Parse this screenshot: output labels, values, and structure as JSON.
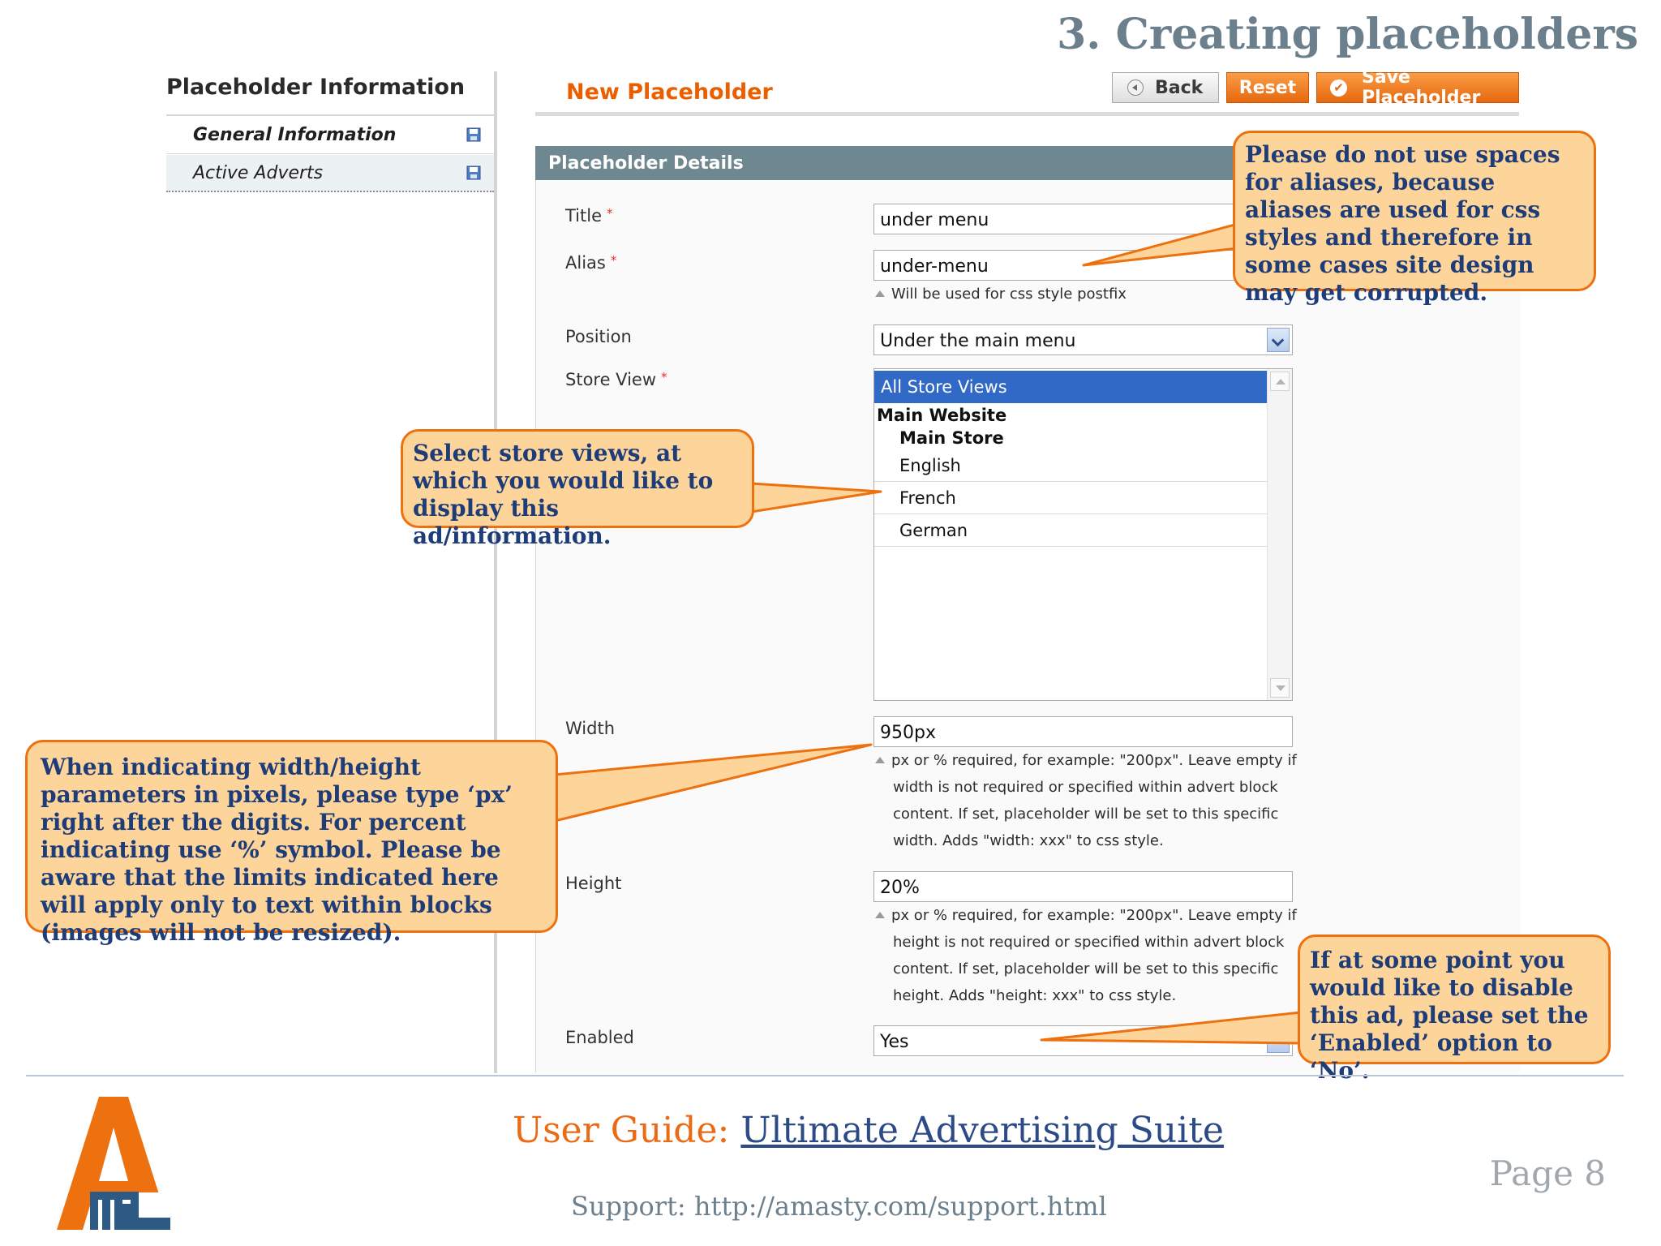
{
  "header": {
    "title": "3. Creating placeholders"
  },
  "sidebar": {
    "heading": "Placeholder Information",
    "items": [
      {
        "label": "General Information",
        "icon": "save-icon"
      },
      {
        "label": "Active Adverts",
        "icon": "save-icon"
      }
    ]
  },
  "form": {
    "heading": "New Placeholder",
    "buttons": {
      "back": "Back",
      "reset": "Reset",
      "save": "Save Placeholder"
    },
    "fieldset_title": "Placeholder Details",
    "required_mark": "*",
    "title": {
      "label": "Title",
      "value": "under menu"
    },
    "alias": {
      "label": "Alias",
      "value": "under-menu",
      "note": "Will be used for css style postfix"
    },
    "position": {
      "label": "Position",
      "value": "Under the main menu"
    },
    "store_view": {
      "label": "Store View",
      "selected": "All Store Views",
      "group": "Main Website",
      "subgroup": "Main Store",
      "options": [
        "English",
        "French",
        "German"
      ]
    },
    "width": {
      "label": "Width",
      "value": "950px",
      "note_lines": [
        "px or % required, for example: \"200px\". Leave empty if",
        "width is not required or specified within advert block",
        "content. If set, placeholder will be set to this specific",
        "width. Adds \"width: xxx\" to css style."
      ]
    },
    "height": {
      "label": "Height",
      "value": "20%",
      "note_lines": [
        "px or % required, for example: \"200px\". Leave empty if",
        "height is not required or specified within advert block",
        "content. If set, placeholder will be set to this specific",
        "height. Adds \"height: xxx\" to css style."
      ]
    },
    "enabled": {
      "label": "Enabled",
      "value": "Yes"
    }
  },
  "callouts": {
    "alias": "Please do not use spaces for aliases, because aliases are used for css styles and therefore in some cases site design may get corrupted.",
    "store": "Select store views, at which you would like to display this ad/information.",
    "width": "When indicating width/height parameters in pixels, please type ‘px’ right after the digits. For percent indicating use ‘%’ symbol. Please be aware that the limits indicated here will apply only to text within blocks (images will not be resized).",
    "enabled": "If at some point you would like to disable this ad, please set the ‘Enabled’ option to ‘No’."
  },
  "footer": {
    "guide_prefix": "User Guide:",
    "guide_link": "Ultimate Advertising Suite",
    "support": "Support: http://amasty.com/support.html",
    "page": "Page 8"
  },
  "colors": {
    "accent_orange": "#eb5e00",
    "callout_fill": "#fdd49a",
    "callout_border": "#ee7110",
    "callout_text": "#1e3d78",
    "fieldset_bar": "#6f8791",
    "selection": "#3169c6"
  }
}
